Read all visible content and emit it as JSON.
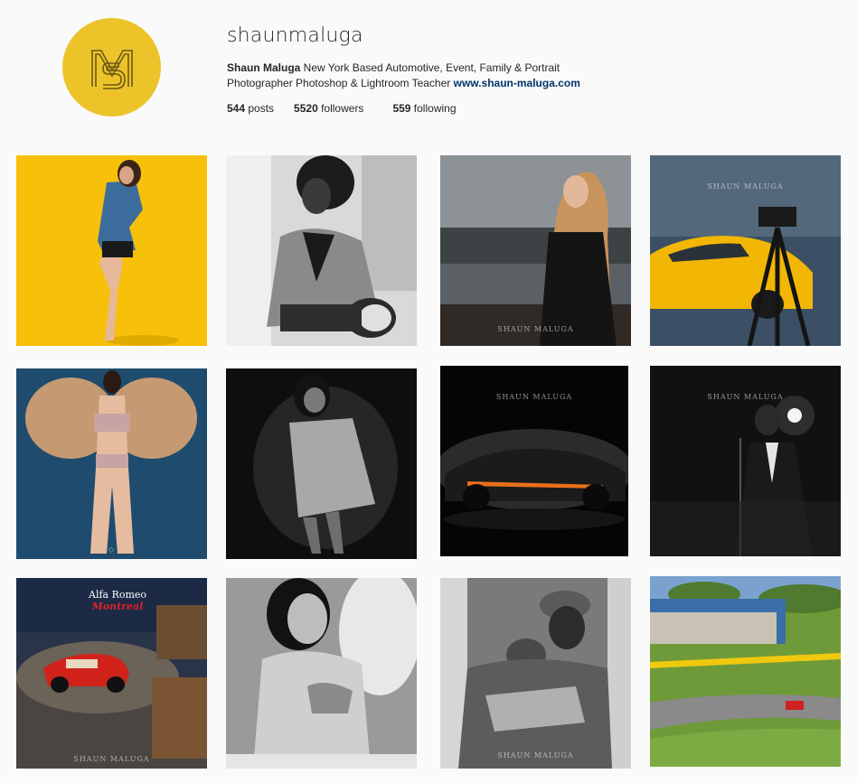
{
  "profile": {
    "username": "shaunmaluga",
    "display_name": "Shaun Maluga",
    "bio": " New York Based Automotive, Event, Family & Portrait Photographer Photoshop & Lightroom Teacher ",
    "website": "www.shaun-maluga.com",
    "avatar_color": "#ecc42a"
  },
  "stats": {
    "posts_count": "544",
    "posts_label": " posts",
    "followers_count": "5520",
    "followers_label": " followers",
    "following_count": "559",
    "following_label": " following"
  },
  "watermark": {
    "text": "SHAUN MALUGA"
  },
  "posts": [
    {
      "subject": "woman in denim jacket on yellow background"
    },
    {
      "subject": "woman on scooter black and white"
    },
    {
      "subject": "woman leaning on car"
    },
    {
      "subject": "camera on tripod with yellow car"
    },
    {
      "subject": "burlesque dancer with feather fans"
    },
    {
      "subject": "woman in white shirt black and white"
    },
    {
      "subject": "black sports car with orange stripes"
    },
    {
      "subject": "singer at microphone"
    },
    {
      "subject": "red Alfa Romeo Montreal",
      "sign_line1": "Alfa Romeo",
      "sign_line2": "Montreal"
    },
    {
      "subject": "smiling woman with feather fan"
    },
    {
      "subject": "couple on subway train"
    },
    {
      "subject": "race track with red car"
    }
  ]
}
